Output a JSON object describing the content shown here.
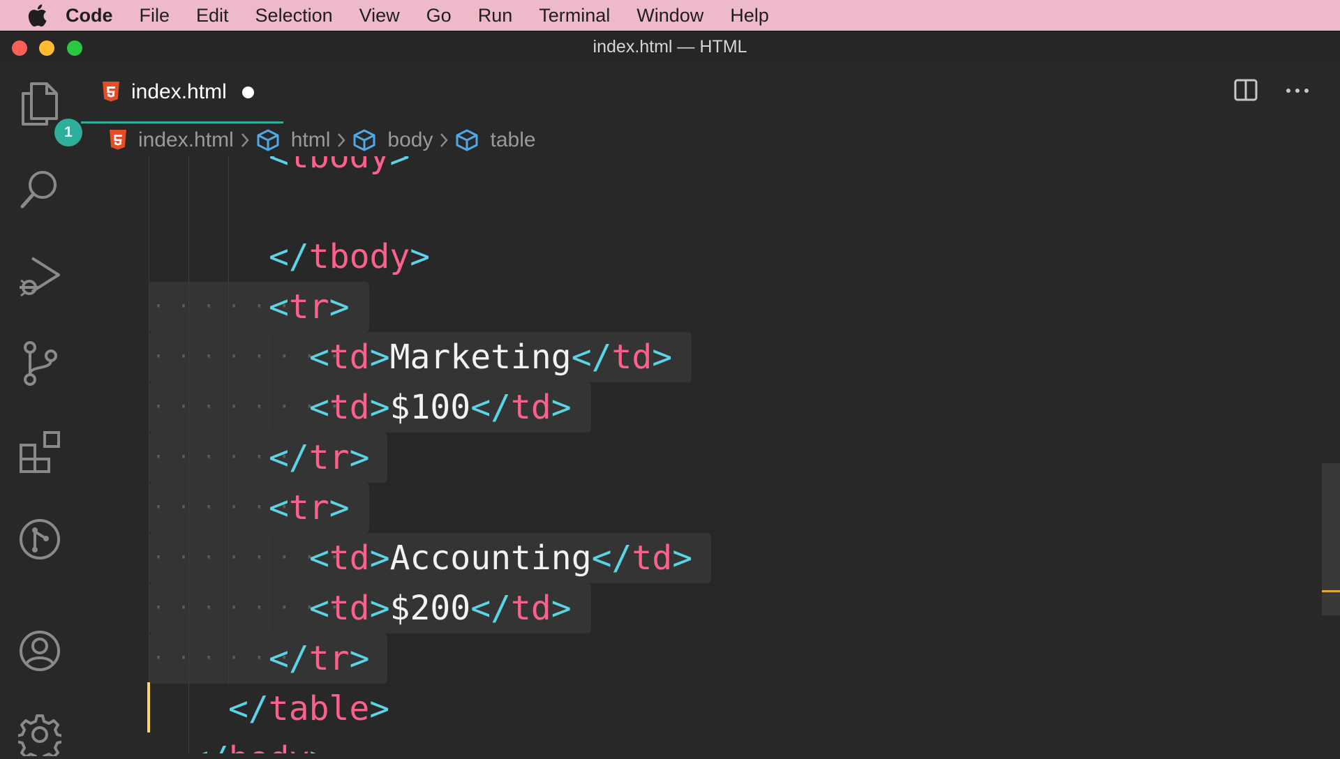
{
  "menubar": {
    "apple_icon": "apple-icon",
    "items": [
      "Code",
      "File",
      "Edit",
      "Selection",
      "View",
      "Go",
      "Run",
      "Terminal",
      "Window",
      "Help"
    ]
  },
  "window": {
    "title": "index.html — HTML"
  },
  "activitybar": {
    "items": [
      {
        "name": "explorer-icon",
        "badge": "1"
      },
      {
        "name": "search-icon"
      },
      {
        "name": "run-debug-icon"
      },
      {
        "name": "source-control-icon"
      },
      {
        "name": "extensions-icon"
      },
      {
        "name": "git-graph-icon"
      },
      {
        "name": "accounts-icon"
      },
      {
        "name": "settings-gear-icon"
      }
    ]
  },
  "tabs": {
    "active": {
      "label": "index.html",
      "dirty": true,
      "icon": "html5-icon"
    }
  },
  "breadcrumb": [
    "index.html",
    "html",
    "body",
    "table"
  ],
  "editor": {
    "lines": [
      "<tbody>",
      "",
      "</tbody>",
      "<tr>",
      "<td>Marketing</td>",
      "<td>$100</td>",
      "</tr>",
      "<tr>",
      "<td>Accounting</td>",
      "<td>$200</td>",
      "</tr>",
      "</table>",
      "</body>"
    ]
  },
  "colors": {
    "menubar_bg": "#eeb9c8",
    "editor_bg": "#282828",
    "tag": "#fc618d",
    "punctuation": "#5ad4e6",
    "text": "#f2f2f2",
    "accent": "#2eaf9c",
    "html_icon": "#e44d26"
  }
}
